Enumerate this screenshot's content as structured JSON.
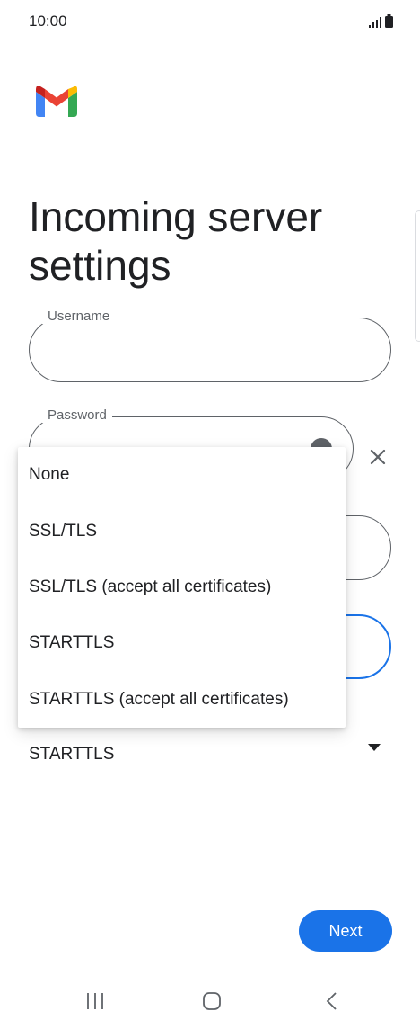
{
  "status_bar": {
    "time": "10:00",
    "signal_icon": "signal-icon",
    "battery_icon": "battery-icon"
  },
  "logo": {
    "icon": "gmail-logo",
    "colors": [
      "#4285f4",
      "#34a853",
      "#fbbc04",
      "#ea4335",
      "#c5221f"
    ]
  },
  "page": {
    "title": "Incoming server settings"
  },
  "form": {
    "username_label": "Username",
    "username_value": "",
    "password_label": "Password",
    "security_type_value": "STARTTLS"
  },
  "security_menu": {
    "options": [
      "None",
      "SSL/TLS",
      "SSL/TLS (accept all certificates)",
      "STARTTLS",
      "STARTTLS (accept all certificates)"
    ]
  },
  "actions": {
    "next_label": "Next"
  },
  "colors": {
    "accent": "#1a73e8",
    "outline": "#5f6368"
  },
  "nav_bar": {
    "recents_icon": "recents-icon",
    "home_icon": "home-icon",
    "back_icon": "back-icon"
  }
}
